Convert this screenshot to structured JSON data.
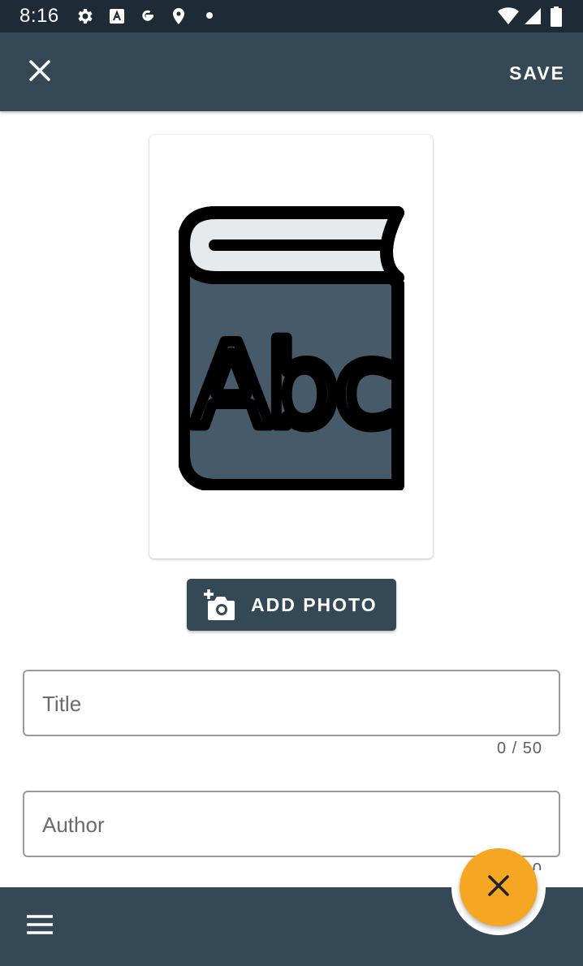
{
  "status_bar": {
    "time": "8:16",
    "icons_left": [
      "gear-icon",
      "a-box-icon",
      "google-icon",
      "location-pin-icon",
      "dot-icon"
    ],
    "icons_right": [
      "wifi-icon",
      "signal-icon",
      "battery-icon"
    ]
  },
  "app_bar": {
    "close_icon": "close-icon",
    "save_label": "SAVE"
  },
  "cover": {
    "placeholder_icon": "book-abc-icon",
    "book_letters": "Abc",
    "colors": {
      "book_body": "#465a69",
      "book_pages": "#e6eaed",
      "outline": "#000000"
    }
  },
  "add_photo": {
    "icon": "add-camera-icon",
    "label": "ADD PHOTO"
  },
  "form": {
    "title": {
      "placeholder": "Title",
      "value": "",
      "counter": "0 / 50"
    },
    "author": {
      "placeholder": "Author",
      "value": "",
      "counter": "0"
    }
  },
  "bottom_bar": {
    "menu_icon": "menu-icon",
    "fab_icon": "close-icon"
  },
  "colors": {
    "status_bar": "#1e2a35",
    "primary": "#354856",
    "accent": "#f5a623",
    "field_border": "#9a9a9a"
  }
}
